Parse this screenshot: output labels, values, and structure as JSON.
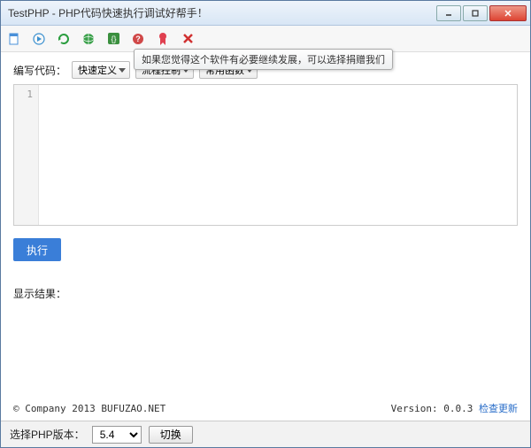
{
  "title": "TestPHP - PHP代码快速执行调试好帮手！",
  "tooltip": "如果您觉得这个软件有必要继续发展，可以选择捐赠我们",
  "labels": {
    "writeCode": "编写代码：",
    "showResult": "显示结果：",
    "selectVersion": "选择PHP版本："
  },
  "dropdowns": {
    "quickDefine": "快速定义",
    "flowControl": "流程控制",
    "commonFunc": "常用函数"
  },
  "editor": {
    "lineNumber": "1",
    "content": ""
  },
  "buttons": {
    "run": "执行",
    "switch": "切换"
  },
  "footer": {
    "copyright": "© Company 2013 BUFUZAO.NET",
    "versionLabel": "Version: ",
    "version": "0.0.3",
    "checkUpdate": "检查更新"
  },
  "phpVersion": "5.4"
}
